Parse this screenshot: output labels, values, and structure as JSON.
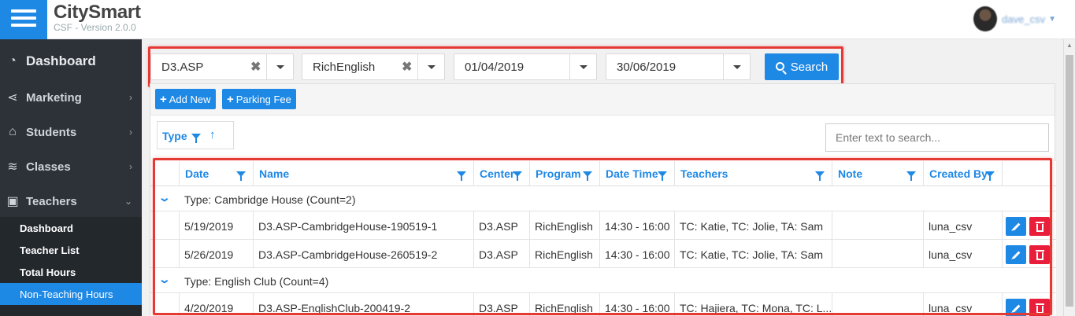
{
  "app": {
    "name": "CitySmart",
    "version": "CSF - Version 2.0.0"
  },
  "user": {
    "name": "dave_csv"
  },
  "sidebar": {
    "items": [
      {
        "label": "Dashboard",
        "icon": "speedometer-icon"
      },
      {
        "label": "Marketing",
        "icon": "share-icon"
      },
      {
        "label": "Students",
        "icon": "graduation-cap-icon"
      },
      {
        "label": "Classes",
        "icon": "layers-icon"
      },
      {
        "label": "Teachers",
        "icon": "briefcase-icon"
      }
    ],
    "submenu": [
      {
        "label": "Dashboard"
      },
      {
        "label": "Teacher List"
      },
      {
        "label": "Total Hours"
      },
      {
        "label": "Non-Teaching Hours",
        "active": true
      }
    ]
  },
  "filters": {
    "center": "D3.ASP",
    "program": "RichEnglish",
    "from_date": "01/04/2019",
    "to_date": "30/06/2019",
    "search_label": "Search"
  },
  "toolbar": {
    "add_new": "Add New",
    "parking_fee": "Parking Fee"
  },
  "grouping": {
    "label": "Type"
  },
  "grid_search": {
    "placeholder": "Enter text to search..."
  },
  "grid": {
    "columns": [
      "Date",
      "Name",
      "Center",
      "Program",
      "Date Time",
      "Teachers",
      "Note",
      "Created By"
    ],
    "groups": [
      {
        "label": "Type: Cambridge House (Count=2)",
        "rows": [
          {
            "date": "5/19/2019",
            "name": "D3.ASP-CambridgeHouse-190519-1",
            "center": "D3.ASP",
            "program": "RichEnglish",
            "datetime": "14:30 - 16:00",
            "teachers": "TC: Katie, TC: Jolie, TA: Sam",
            "note": "",
            "created_by": "luna_csv"
          },
          {
            "date": "5/26/2019",
            "name": "D3.ASP-CambridgeHouse-260519-2",
            "center": "D3.ASP",
            "program": "RichEnglish",
            "datetime": "14:30 - 16:00",
            "teachers": "TC: Katie, TC: Jolie, TA: Sam",
            "note": "",
            "created_by": "luna_csv"
          }
        ]
      },
      {
        "label": "Type: English Club (Count=4)",
        "rows": [
          {
            "date": "4/20/2019",
            "name": "D3.ASP-EnglishClub-200419-2",
            "center": "D3.ASP",
            "program": "RichEnglish",
            "datetime": "14:30 - 16:00",
            "teachers": "TC: Hajiera, TC: Mona, TC: L...",
            "note": "",
            "created_by": "luna_csv"
          }
        ]
      }
    ]
  },
  "colors": {
    "accent": "#1e88e5",
    "danger": "#e91e3a",
    "sidebar": "#2c3238",
    "highlight": "#e53935"
  }
}
